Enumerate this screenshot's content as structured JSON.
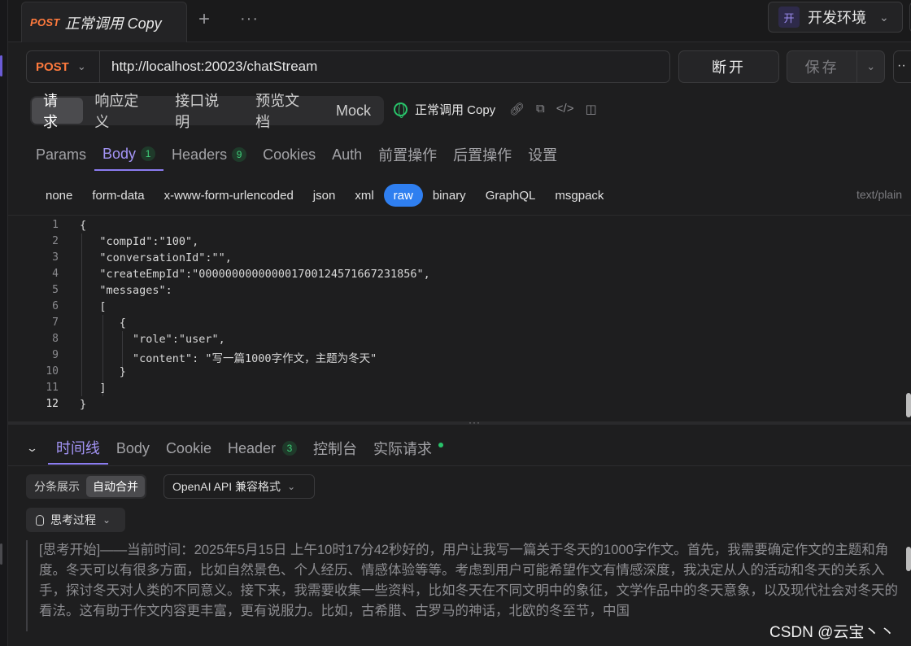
{
  "tab": {
    "method": "POST",
    "name": "正常调用 Copy"
  },
  "env": {
    "badge": "开",
    "label": "开发环境"
  },
  "request": {
    "method": "POST",
    "url": "http://localhost:20023/chatStream",
    "disconnect_label": "断开",
    "save_label": "保存"
  },
  "segments": [
    "请求",
    "响应定义",
    "接口说明",
    "预览文档",
    "Mock"
  ],
  "doc_title": "正常调用 Copy",
  "param_tabs": [
    {
      "label": "Params"
    },
    {
      "label": "Body",
      "count": "1"
    },
    {
      "label": "Headers",
      "count": "9"
    },
    {
      "label": "Cookies"
    },
    {
      "label": "Auth"
    },
    {
      "label": "前置操作"
    },
    {
      "label": "后置操作"
    },
    {
      "label": "设置"
    }
  ],
  "body_types": [
    "none",
    "form-data",
    "x-www-form-urlencoded",
    "json",
    "xml",
    "raw",
    "binary",
    "GraphQL",
    "msgpack"
  ],
  "content_type": "text/plain",
  "code_lines": [
    "{",
    "   \"compId\":\"100\",",
    "   \"conversationId\":\"\",",
    "   \"createEmpId\":\"000000000000001700124571667231856\",",
    "   \"messages\":",
    "   [",
    "      {",
    "        \"role\":\"user\",",
    "        \"content\": \"写一篇1000字作文，主题为冬天\"",
    "      }",
    "   ]",
    "}"
  ],
  "line_numbers": [
    "1",
    "2",
    "3",
    "4",
    "5",
    "6",
    "7",
    "8",
    "9",
    "10",
    "11",
    "12"
  ],
  "response_tabs": [
    {
      "label": "时间线"
    },
    {
      "label": "Body"
    },
    {
      "label": "Cookie"
    },
    {
      "label": "Header",
      "count": "3"
    },
    {
      "label": "控制台"
    },
    {
      "label": "实际请求"
    }
  ],
  "view_modes": [
    "分条展示",
    "自动合并"
  ],
  "format_select": "OpenAI API 兼容格式",
  "think_label": "思考过程",
  "thought_text": "[思考开始]——当前时间：2025年5月15日 上午10时17分42秒好的，用户让我写一篇关于冬天的1000字作文。首先，我需要确定作文的主题和角度。冬天可以有很多方面，比如自然景色、个人经历、情感体验等等。考虑到用户可能希望作文有情感深度，我决定从人的活动和冬天的关系入手，探讨冬天对人类的不同意义。接下来，我需要收集一些资料，比如冬天在不同文明中的象征，文学作品中的冬天意象，以及现代社会对冬天的看法。这有助于作文内容更丰富，更有说服力。比如，古希腊、古罗马的神话，北欧的冬至节，中国",
  "watermark": "CSDN @云宝丶丶"
}
